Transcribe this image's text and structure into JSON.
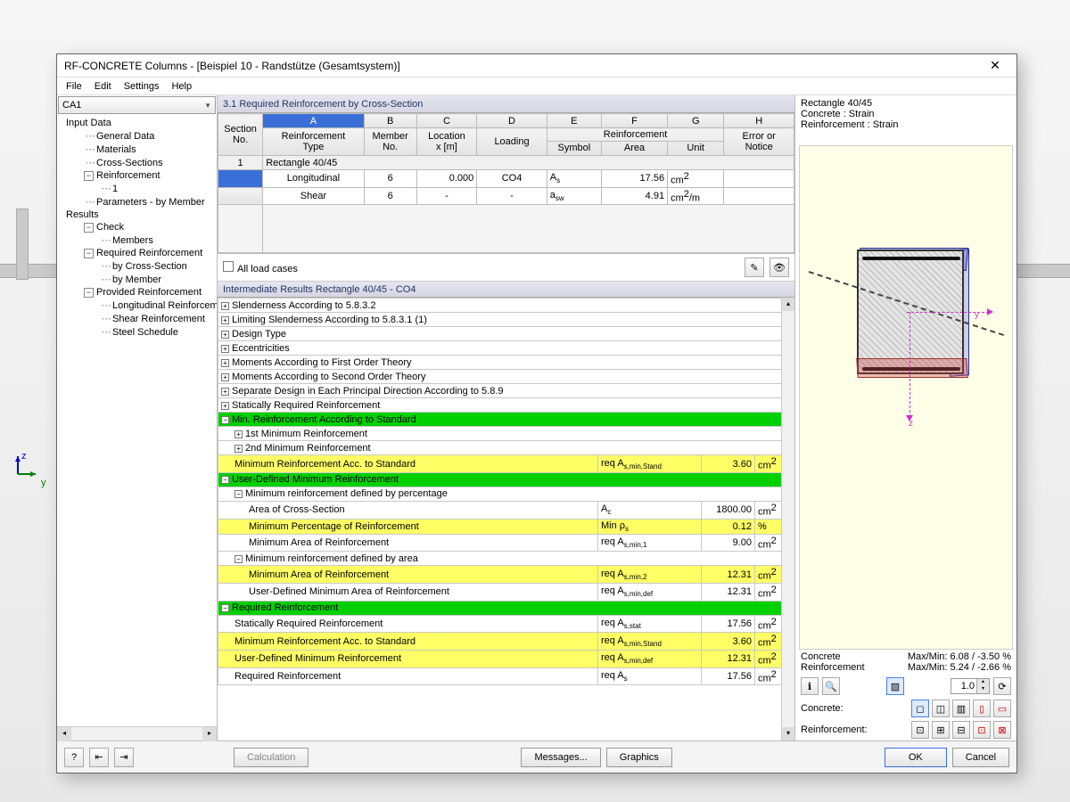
{
  "window": {
    "title": "RF-CONCRETE Columns - [Beispiel 10 - Randstütze (Gesamtsystem)]",
    "close": "✕"
  },
  "menu": {
    "file": "File",
    "edit": "Edit",
    "settings": "Settings",
    "help": "Help"
  },
  "combo": {
    "value": "CA1"
  },
  "tree": {
    "input": "Input Data",
    "general": "General Data",
    "materials": "Materials",
    "cross": "Cross-Sections",
    "reinf": "Reinforcement",
    "reinf_1": "1",
    "params": "Parameters - by Member",
    "results": "Results",
    "check": "Check",
    "members": "Members",
    "reqreinf": "Required Reinforcement",
    "bycs": "by Cross-Section",
    "bymem": "by Member",
    "provided": "Provided Reinforcement",
    "long": "Longitudinal Reinforcement",
    "shear": "Shear Reinforcement",
    "steel": "Steel Schedule"
  },
  "pane": {
    "title": "3.1 Required Reinforcement by Cross-Section",
    "cols": {
      "letters": [
        "A",
        "B",
        "C",
        "D",
        "E",
        "F",
        "G",
        "H"
      ],
      "section": "Section\nNo.",
      "reinf": "Reinforcement\nType",
      "member": "Member\nNo.",
      "loc": "Location\nx [m]",
      "loading": "Loading",
      "symbol": "Symbol",
      "area": "Area",
      "unit": "Unit",
      "reinf_group": "Reinforcement",
      "err": "Error or\nNotice"
    },
    "section_header": "Rectangle 40/45",
    "rows": [
      {
        "type": "Longitudinal",
        "member": "6",
        "x": "0.000",
        "loading": "CO4",
        "symbol": "A<sub>s</sub>",
        "area": "17.56",
        "unit": "cm<sup>2</sup>"
      },
      {
        "type": "Shear",
        "member": "6",
        "x": "-",
        "loading": "-",
        "symbol": "a<sub>sw</sub>",
        "area": "4.91",
        "unit": "cm<sup>2</sup>/m"
      }
    ],
    "allcases": "All load cases"
  },
  "details": {
    "title": "Intermediate Results Rectangle 40/45 - CO4",
    "items": [
      {
        "lvl": 0,
        "exp": "+",
        "label": "Slenderness According to 5.8.3.2"
      },
      {
        "lvl": 0,
        "exp": "+",
        "label": "Limiting Slenderness According to 5.8.3.1 (1)"
      },
      {
        "lvl": 0,
        "exp": "+",
        "label": "Design Type"
      },
      {
        "lvl": 0,
        "exp": "+",
        "label": "Eccentricities"
      },
      {
        "lvl": 0,
        "exp": "+",
        "label": "Moments According to First Order Theory"
      },
      {
        "lvl": 0,
        "exp": "+",
        "label": "Moments According to Second Order Theory"
      },
      {
        "lvl": 0,
        "exp": "+",
        "label": "Separate Design in Each Principal Direction According to 5.8.9"
      },
      {
        "lvl": 0,
        "exp": "+",
        "label": "Statically Required Reinforcement"
      },
      {
        "lvl": 0,
        "exp": "-",
        "label": "Min. Reinforcement According to Standard",
        "cls": "green"
      },
      {
        "lvl": 1,
        "exp": "+",
        "label": "1st Minimum Reinforcement"
      },
      {
        "lvl": 1,
        "exp": "+",
        "label": "2nd Minimum Reinforcement"
      },
      {
        "lvl": 1,
        "label": "Minimum Reinforcement Acc. to Standard",
        "sym": "req A<sub>s,min,Stand</sub>",
        "val": "3.60",
        "unit": "cm<sup>2</sup>",
        "cls": "yellow"
      },
      {
        "lvl": 0,
        "exp": "-",
        "label": "User-Defined Minimum Reinforcement",
        "cls": "green"
      },
      {
        "lvl": 1,
        "exp": "-",
        "label": "Minimum reinforcement defined by percentage"
      },
      {
        "lvl": 2,
        "label": "Area of Cross-Section",
        "sym": "A<sub>c</sub>",
        "val": "1800.00",
        "unit": "cm<sup>2</sup>"
      },
      {
        "lvl": 2,
        "label": "Minimum Percentage of Reinforcement",
        "sym": "Min ρ<sub>s</sub>",
        "val": "0.12",
        "unit": "%",
        "cls": "yellow"
      },
      {
        "lvl": 2,
        "label": "Minimum Area of Reinforcement",
        "sym": "req A<sub>s,min,1</sub>",
        "val": "9.00",
        "unit": "cm<sup>2</sup>"
      },
      {
        "lvl": 1,
        "exp": "-",
        "label": "Minimum reinforcement defined by area"
      },
      {
        "lvl": 2,
        "label": "Minimum Area of Reinforcement",
        "sym": "req A<sub>s,min,2</sub>",
        "val": "12.31",
        "unit": "cm<sup>2</sup>",
        "cls": "yellow"
      },
      {
        "lvl": 2,
        "label": "User-Defined Minimum Area of Reinforcement",
        "sym": "req A<sub>s,min,def</sub>",
        "val": "12.31",
        "unit": "cm<sup>2</sup>"
      },
      {
        "lvl": 0,
        "exp": "-",
        "label": "Required Reinforcement",
        "cls": "green"
      },
      {
        "lvl": 1,
        "label": "Statically Required Reinforcement",
        "sym": "req A<sub>s,stat</sub>",
        "val": "17.56",
        "unit": "cm<sup>2</sup>"
      },
      {
        "lvl": 1,
        "label": "Minimum Reinforcement Acc. to Standard",
        "sym": "req A<sub>s,min,Stand</sub>",
        "val": "3.60",
        "unit": "cm<sup>2</sup>",
        "cls": "yellow"
      },
      {
        "lvl": 1,
        "label": "User-Defined Minimum Reinforcement",
        "sym": "req A<sub>s,min,def</sub>",
        "val": "12.31",
        "unit": "cm<sup>2</sup>",
        "cls": "yellow"
      },
      {
        "lvl": 1,
        "label": "Required Reinforcement",
        "sym": "req A<sub>s</sub>",
        "val": "17.56",
        "unit": "cm<sup>2</sup>"
      }
    ]
  },
  "right": {
    "l1": "Rectangle 40/45",
    "l2": "Concrete : Strain",
    "l3": "Reinforcement : Strain",
    "conc": "Concrete",
    "concv": "Max/Min: 6.08 / -3.50 %",
    "reinf": "Reinforcement",
    "reinfv": "Max/Min: 5.24 / -2.66 %",
    "spin": "1.0",
    "lab_conc": "Concrete:",
    "lab_reinf": "Reinforcement:"
  },
  "footer": {
    "calc": "Calculation",
    "messages": "Messages...",
    "graphics": "Graphics",
    "ok": "OK",
    "cancel": "Cancel"
  },
  "axis": {
    "z": "z",
    "y": "y"
  }
}
